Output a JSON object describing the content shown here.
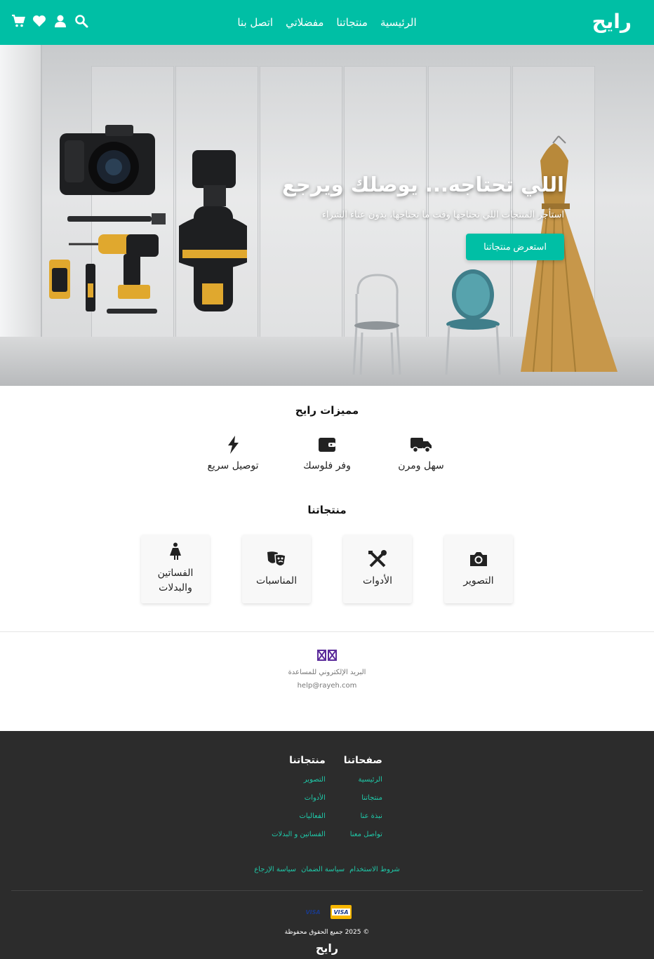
{
  "header": {
    "logo": "رايح",
    "nav": [
      "الرئيسية",
      "منتجاتنا",
      "مفضلاتي",
      "اتصل بنا"
    ],
    "icons": [
      "search-icon",
      "user-icon",
      "heart-icon",
      "cart-icon"
    ],
    "background": "#00bfa5"
  },
  "hero": {
    "title": "اللي تحتاجه... يوصلك ويرجع",
    "subtitle": "استأجر المنتجات اللي تحتاجها وقت ما تحتاجها، بدون عناء الشراء",
    "button": "استعرض منتجاتنا"
  },
  "features": {
    "title": "مميزات رايح",
    "items": [
      {
        "label": "سهل ومرن",
        "icon": "truck-icon"
      },
      {
        "label": "وفر فلوسك",
        "icon": "wallet-icon"
      },
      {
        "label": "توصيل سريع",
        "icon": "bolt-icon"
      }
    ]
  },
  "products": {
    "title": "منتجاتنا",
    "items": [
      {
        "label": "التصوير",
        "icon": "camera-icon"
      },
      {
        "label": "الأدوات",
        "icon": "tools-icon"
      },
      {
        "label": "المناسبات",
        "icon": "masks-icon"
      },
      {
        "label": "الفساتين والبدلات",
        "icon": "person-dress-icon"
      }
    ]
  },
  "contact": {
    "label": "البريد الإلكتروني للمساعدة",
    "email": "help@rayeh.com"
  },
  "footer": {
    "pages_title": "صفحاتنا",
    "pages": [
      "الرئيسية",
      "منتجاتنا",
      "نبذة عنا",
      "تواصل معنا"
    ],
    "products_title": "منتجاتنا",
    "products": [
      "التصوير",
      "الأدوات",
      "الفعاليات",
      "الفساتين و البدلات"
    ],
    "policies": [
      "شروط الاستخدام",
      "سياسة الضمان",
      "سياسة الإرجاع"
    ],
    "payment": [
      "VISA",
      "VISA"
    ],
    "copyright": "© 2025 جميع الحقوق محفوظة",
    "logo": "رايح"
  }
}
